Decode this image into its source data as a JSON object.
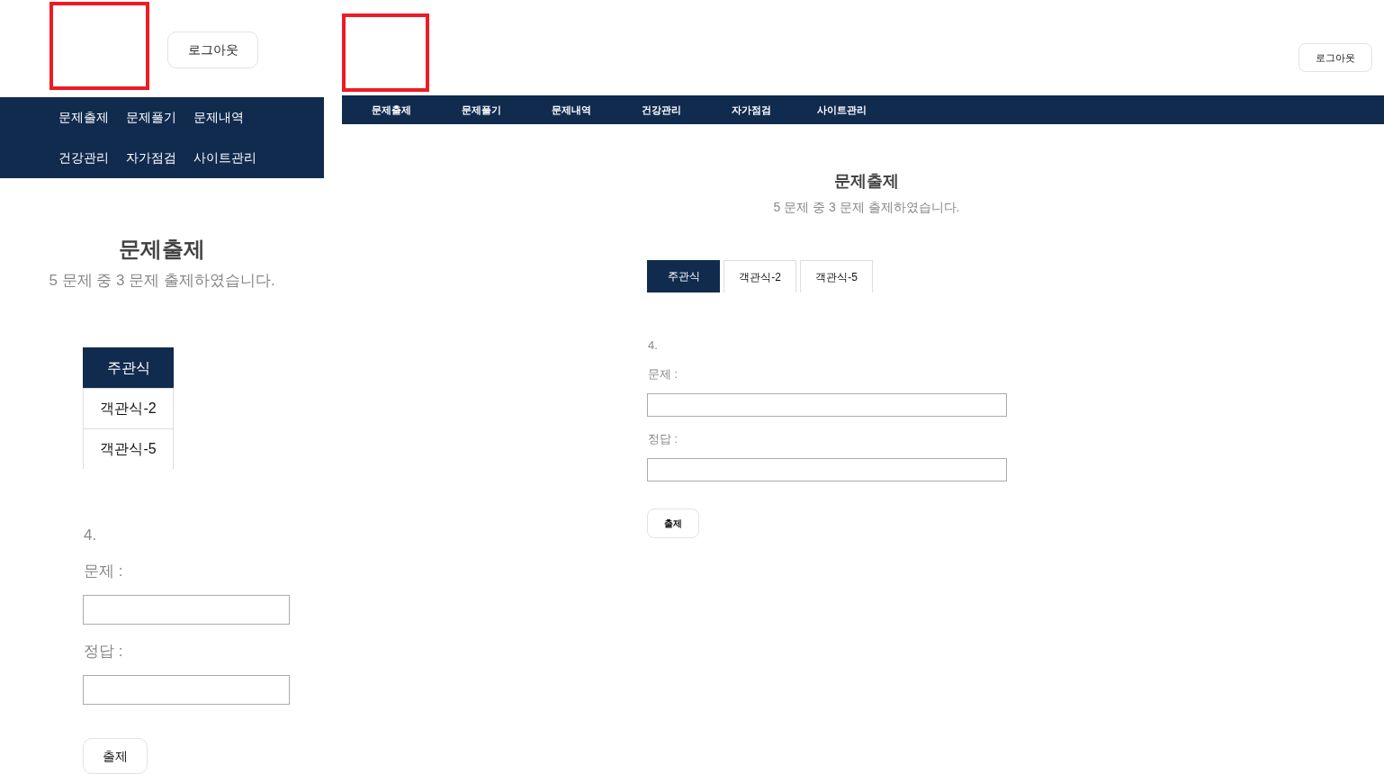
{
  "mobile_view": {
    "logout_button": "로그아웃",
    "nav": [
      {
        "label": "문제출제"
      },
      {
        "label": "문제풀기"
      },
      {
        "label": "문제내역"
      },
      {
        "label": "건강관리"
      },
      {
        "label": "자가점검"
      },
      {
        "label": "사이트관리"
      }
    ],
    "title": "문제출제",
    "subtitle": "5 문제 중 3 문제 출제하였습니다.",
    "tabs": [
      {
        "label": "주관식",
        "selected": true
      },
      {
        "label": "객관식-2",
        "selected": false
      },
      {
        "label": "객관식-5",
        "selected": false
      }
    ],
    "question": {
      "number": "4.",
      "fields": [
        {
          "label": "문제 :"
        },
        {
          "label": "정답 :"
        }
      ],
      "submit_button": "출제"
    }
  },
  "desktop_view": {
    "logout_button": "로그아웃",
    "nav": [
      {
        "label": "문제출제"
      },
      {
        "label": "문제풀기"
      },
      {
        "label": "문제내역"
      },
      {
        "label": "건강관리"
      },
      {
        "label": "자가점검"
      },
      {
        "label": "사이트관리"
      }
    ],
    "title": "문제출제",
    "subtitle": "5 문제 중 3 문제 출제하였습니다.",
    "tabs": [
      {
        "label": "주관식",
        "selected": true
      },
      {
        "label": "객관식-2",
        "selected": false
      },
      {
        "label": "객관식-5",
        "selected": false
      }
    ],
    "question": {
      "number": "4.",
      "fields": [
        {
          "label": "문제 :"
        },
        {
          "label": "정답 :"
        }
      ],
      "submit_button": "출제"
    }
  }
}
